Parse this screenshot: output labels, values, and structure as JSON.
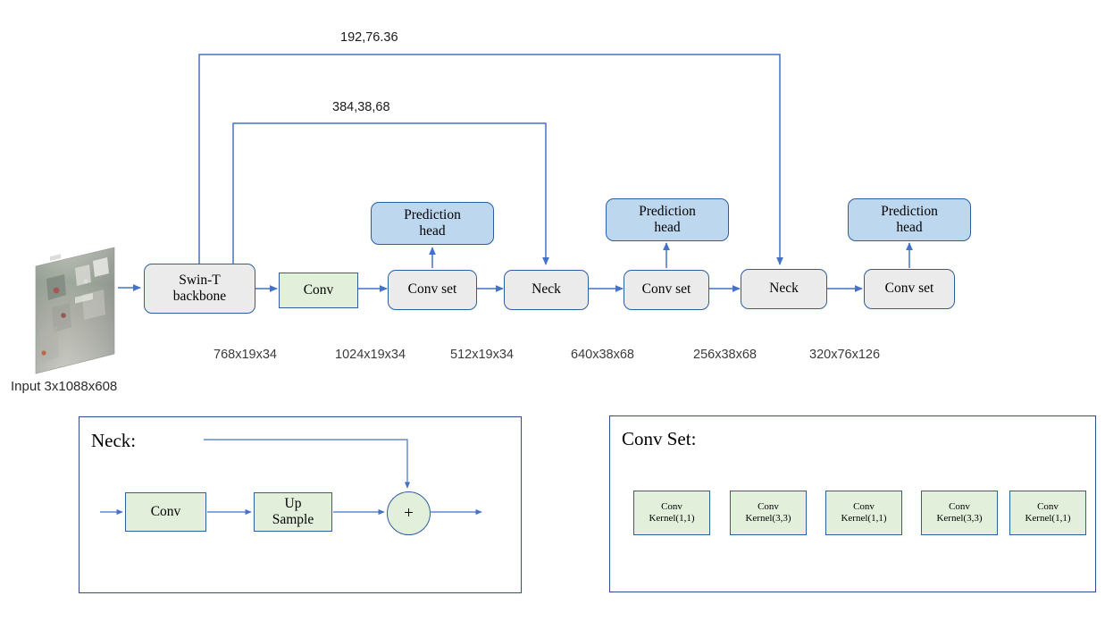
{
  "diagram": {
    "title_hidden": "",
    "input": {
      "label": "Input 3x1088x608",
      "thumbnail_name": "street-scene-frame"
    },
    "skip_connections": [
      {
        "label": "192,76.36"
      },
      {
        "label": "384,38,68"
      }
    ],
    "pipeline": [
      {
        "id": "backbone",
        "label": "Swin-T\nbackbone",
        "line1": "Swin-T",
        "line2": "backbone",
        "style": "grey"
      },
      {
        "id": "conv1",
        "label": "Conv",
        "line1": "Conv",
        "line2": "",
        "style": "green"
      },
      {
        "id": "convset1",
        "label": "Conv set",
        "line1": "Conv set",
        "line2": "",
        "style": "grey"
      },
      {
        "id": "neck1",
        "label": "Neck",
        "line1": "Neck",
        "line2": "",
        "style": "grey"
      },
      {
        "id": "convset2",
        "label": "Conv set",
        "line1": "Conv set",
        "line2": "",
        "style": "grey"
      },
      {
        "id": "neck2",
        "label": "Neck",
        "line1": "Neck",
        "line2": "",
        "style": "grey"
      },
      {
        "id": "convset3",
        "label": "Conv set",
        "line1": "Conv set",
        "line2": "",
        "style": "grey"
      }
    ],
    "prediction_heads": [
      {
        "line1": "Prediction",
        "line2": "head"
      },
      {
        "line1": "Prediction",
        "line2": "head"
      },
      {
        "line1": "Prediction",
        "line2": "head"
      }
    ],
    "tensor_shapes": [
      "768x19x34",
      "1024x19x34",
      "512x19x34",
      "640x38x68",
      "256x38x68",
      "320x76x126"
    ],
    "neck_panel": {
      "title": "Neck:",
      "blocks": [
        {
          "line1": "Conv",
          "line2": ""
        },
        {
          "line1": "Up",
          "line2": "Sample"
        }
      ],
      "adder_symbol": "+"
    },
    "convset_panel": {
      "title": "Conv Set:",
      "blocks": [
        {
          "line1": "Conv",
          "line2": "Kernel(1,1)"
        },
        {
          "line1": "Conv",
          "line2": "Kernel(3,3)"
        },
        {
          "line1": "Conv",
          "line2": "Kernel(1,1)"
        },
        {
          "line1": "Conv",
          "line2": "Kernel(3,3)"
        },
        {
          "line1": "Conv",
          "line2": "Kernel(1,1)"
        }
      ]
    },
    "colors": {
      "grey_fill": "#ebebeb",
      "blue_fill": "#bdd7ee",
      "green_fill": "#e2efda",
      "stroke": "#2e5e9e",
      "arrow": "#4472c4",
      "panel_border": "#2b4f86"
    }
  }
}
